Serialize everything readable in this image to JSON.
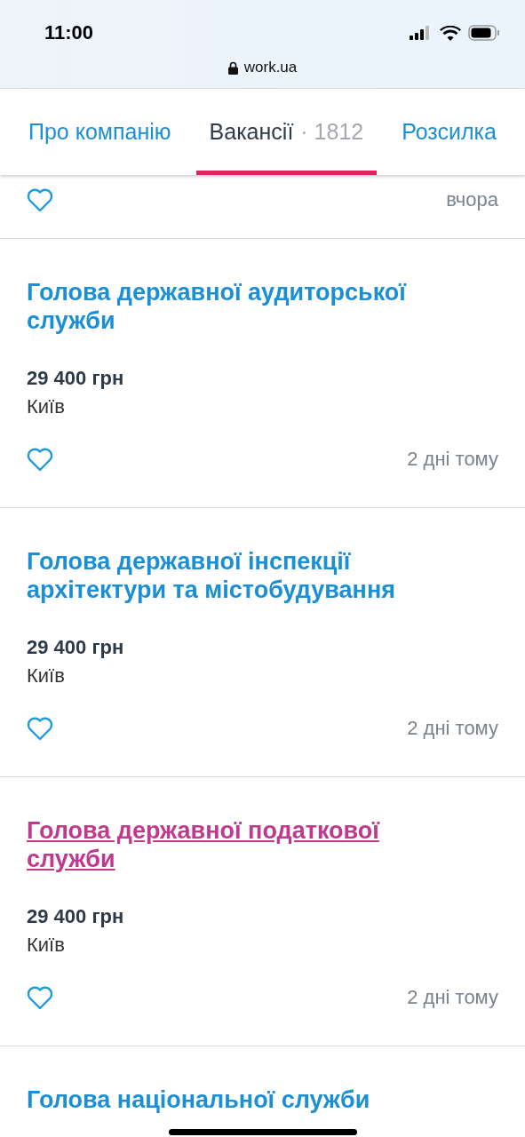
{
  "status_bar": {
    "time": "11:00"
  },
  "address_bar": {
    "url": "work.ua"
  },
  "tabs": [
    {
      "label": "Про компанію",
      "selected": false
    },
    {
      "label": "Вакансії",
      "count": "· 1812",
      "selected": true
    },
    {
      "label": "Розсилка",
      "selected": false
    }
  ],
  "jobs": [
    {
      "posted": "вчора",
      "favorite": false
    },
    {
      "title": "Голова державної аудиторської служби",
      "salary": "29 400 грн",
      "city": "Київ",
      "posted": "2 дні тому",
      "favorite": false,
      "visited": false
    },
    {
      "title": "Голова державної інспекції архітектури та містобудування",
      "salary": "29 400 грн",
      "city": "Київ",
      "posted": "2 дні тому",
      "favorite": false,
      "visited": false
    },
    {
      "title": "Голова державної податкової служби",
      "salary": "29 400 грн",
      "city": "Київ",
      "posted": "2 дні тому",
      "favorite": false,
      "visited": true
    },
    {
      "title": "Голова національної служби",
      "visited": false
    }
  ]
}
